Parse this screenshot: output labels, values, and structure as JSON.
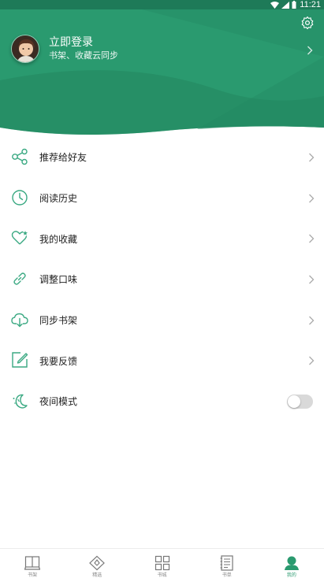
{
  "status_bar": {
    "time": "11:21"
  },
  "profile": {
    "title": "立即登录",
    "subtitle": "书架、收藏云同步"
  },
  "menu": [
    {
      "label": "推荐给好友",
      "icon": "share-icon",
      "trailing": "arrow"
    },
    {
      "label": "阅读历史",
      "icon": "clock-icon",
      "trailing": "arrow"
    },
    {
      "label": "我的收藏",
      "icon": "heart-star-icon",
      "trailing": "arrow"
    },
    {
      "label": "调整口味",
      "icon": "link-icon",
      "trailing": "arrow"
    },
    {
      "label": "同步书架",
      "icon": "cloud-download-icon",
      "trailing": "arrow"
    },
    {
      "label": "我要反馈",
      "icon": "edit-icon",
      "trailing": "arrow"
    },
    {
      "label": "夜间模式",
      "icon": "moon-icon",
      "trailing": "toggle",
      "toggle_on": false
    }
  ],
  "tabs": [
    {
      "label": "书架",
      "icon": "bookshelf-icon",
      "active": false
    },
    {
      "label": "精选",
      "icon": "diamond-icon",
      "active": false
    },
    {
      "label": "书城",
      "icon": "grid-icon",
      "active": false
    },
    {
      "label": "书单",
      "icon": "list-book-icon",
      "active": false
    },
    {
      "label": "我的",
      "icon": "user-icon",
      "active": true
    }
  ],
  "colors": {
    "primary": "#2a9a6f",
    "primary_dark": "#1e7a58",
    "icon_green": "#3aa982"
  }
}
